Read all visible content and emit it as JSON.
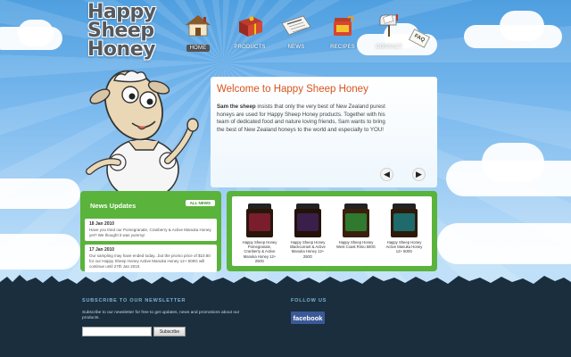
{
  "logo": {
    "line1": "Happy",
    "line2": "Sheep",
    "line3": "Honey"
  },
  "nav": {
    "items": [
      {
        "label": "HOME",
        "icon": "house-icon",
        "active": true
      },
      {
        "label": "PRODUCTS",
        "icon": "gift-box-icon",
        "active": false
      },
      {
        "label": "NEWS",
        "icon": "newspaper-icon",
        "active": false
      },
      {
        "label": "RECIPES",
        "icon": "honey-pot-icon",
        "active": false
      },
      {
        "label": "CONTACT",
        "icon": "mailbox-icon",
        "active": false
      }
    ],
    "faq_label": "FAQ"
  },
  "welcome": {
    "title": "Welcome to Happy Sheep Honey",
    "lead": "Sam the sheep",
    "body": " insists that only the very best of New Zealand purest honeys are used for Happy Sheep Honey products. Together with his team of dedicated food and nature loving friends, Sam wants to bring the best of New Zealand honeys to the world and especially to YOU!",
    "prev_icon": "arrow-left-icon",
    "next_icon": "arrow-right-icon"
  },
  "news": {
    "title": "News Updates",
    "all_news_label": "ALL NEWS",
    "items": [
      {
        "date": "18 Jan 2010",
        "text": "Have you tried our Pomegranate, Cranberry & Active Manuka Honey yet? We thought it was yummy!"
      },
      {
        "date": "17 Jan 2010",
        "text": "Our sampling may have ended today...but the promo price of $10.80 for our Happy Sheep Honey Active Manuka Honey 12+ 500G will continue until 27th Jan 2010."
      }
    ]
  },
  "products": [
    {
      "name": "Happy Sheep Honey Pomegranate, Cranberry & Active Manuka Honey 12+ 250G",
      "label_color": "#7a1d2c"
    },
    {
      "name": "Happy Sheep Honey Blackcurrant & Active Manuka Honey 12+ 250G",
      "label_color": "#3a1f4a"
    },
    {
      "name": "Happy Sheep Honey West Coast Rimu 500G",
      "label_color": "#2f7a2f"
    },
    {
      "name": "Happy Sheep Honey Active Manuka Honey 12+ 500G",
      "label_color": "#1f6a6a"
    }
  ],
  "footer": {
    "newsletter_heading": "SUBSCRIBE TO OUR NEWSLETTER",
    "newsletter_text": "Subscribe to our newsletter for free to get updates, news and promotions about our products.",
    "email_value": "",
    "subscribe_label": "Subscribe",
    "follow_heading": "FOLLOW US",
    "facebook_label": "facebook"
  },
  "colors": {
    "accent_green": "#5ab33a",
    "title_orange": "#d8541e",
    "footer_bg": "#1a2e3d",
    "facebook_blue": "#3b5998"
  }
}
